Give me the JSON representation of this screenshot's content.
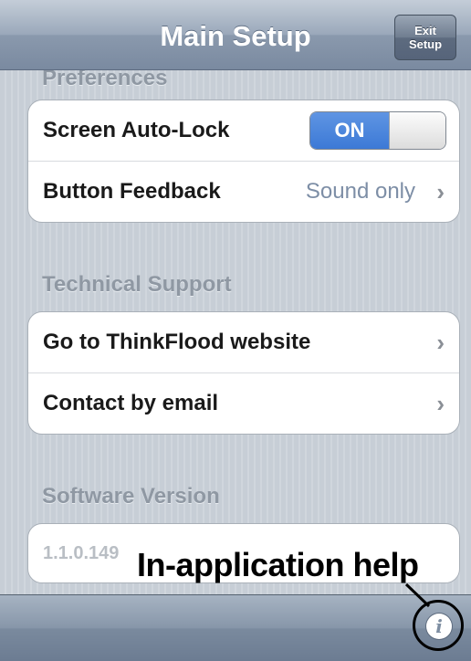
{
  "navbar": {
    "title": "Main Setup",
    "exit_button": [
      "Exit",
      "Setup"
    ]
  },
  "preferences": {
    "header": "Preferences",
    "screen_auto_lock": {
      "label": "Screen Auto-Lock",
      "toggle_label": "ON",
      "state": true
    },
    "button_feedback": {
      "label": "Button Feedback",
      "value": "Sound only"
    }
  },
  "technical_support": {
    "header": "Technical Support",
    "items": [
      {
        "label": "Go to ThinkFlood website"
      },
      {
        "label": "Contact by email"
      }
    ]
  },
  "software_version": {
    "header": "Software Version",
    "value": "1.1.0.149"
  },
  "annotation": {
    "text": "In-application help"
  },
  "icons": {
    "chevron": "chevron-right-icon",
    "info": "info-icon"
  },
  "colors": {
    "toggle_on": "#3c79d6",
    "navbar": "#8a99ad",
    "value_text": "#7d8ea6"
  }
}
